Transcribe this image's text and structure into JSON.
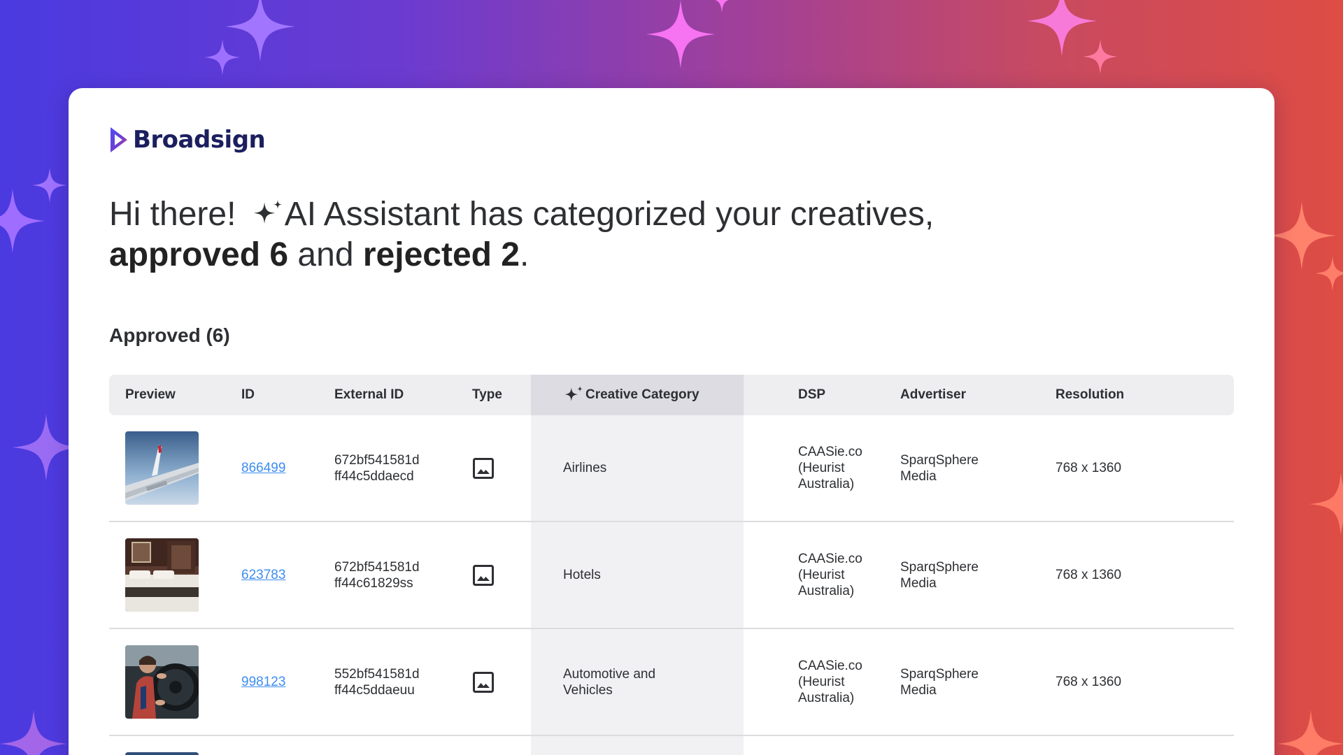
{
  "brand": {
    "name": "Broadsign"
  },
  "headline": {
    "greeting": "Hi there!",
    "line1_rest": "AI Assistant has categorized your creatives,",
    "approved": "approved 6",
    "connector": "and",
    "rejected": "rejected 2",
    "period": "."
  },
  "section": {
    "title": "Approved (6)"
  },
  "table": {
    "headers": {
      "preview": "Preview",
      "id": "ID",
      "external_id": "External ID",
      "type": "Type",
      "category": "Creative Category",
      "dsp": "DSP",
      "advertiser": "Advertiser",
      "resolution": "Resolution"
    },
    "rows": [
      {
        "preview_icon": "airplane-wing-thumbnail",
        "id": "866499",
        "external_id_1": "672bf541581d",
        "external_id_2": "ff44c5ddaecd",
        "type_icon": "image-icon",
        "category_1": "Airlines",
        "category_2": "",
        "dsp_1": "CAASie.co",
        "dsp_2": "(Heurist",
        "dsp_3": "Australia)",
        "advertiser_1": "SparqSphere",
        "advertiser_2": "Media",
        "resolution": "768 x 1360"
      },
      {
        "preview_icon": "hotel-room-thumbnail",
        "id": "623783",
        "external_id_1": "672bf541581d",
        "external_id_2": "ff44c61829ss",
        "type_icon": "image-icon",
        "category_1": "Hotels",
        "category_2": "",
        "dsp_1": "CAASie.co",
        "dsp_2": "(Heurist",
        "dsp_3": "Australia)",
        "advertiser_1": "SparqSphere",
        "advertiser_2": "Media",
        "resolution": "768 x 1360"
      },
      {
        "preview_icon": "car-driver-thumbnail",
        "id": "998123",
        "external_id_1": "552bf541581d",
        "external_id_2": "ff44c5ddaeuu",
        "type_icon": "image-icon",
        "category_1": "Automotive and",
        "category_2": "Vehicles",
        "dsp_1": "CAASie.co",
        "dsp_2": "(Heurist",
        "dsp_3": "Australia)",
        "advertiser_1": "SparqSphere",
        "advertiser_2": "Media",
        "resolution": "768 x 1360"
      }
    ]
  },
  "colors": {
    "link": "#3d8df0",
    "brand_navy": "#1b1f5e",
    "sparkle_violet": "#a66cff",
    "sparkle_pink": "#f472f0",
    "sparkle_coral": "#ff7f6e"
  }
}
